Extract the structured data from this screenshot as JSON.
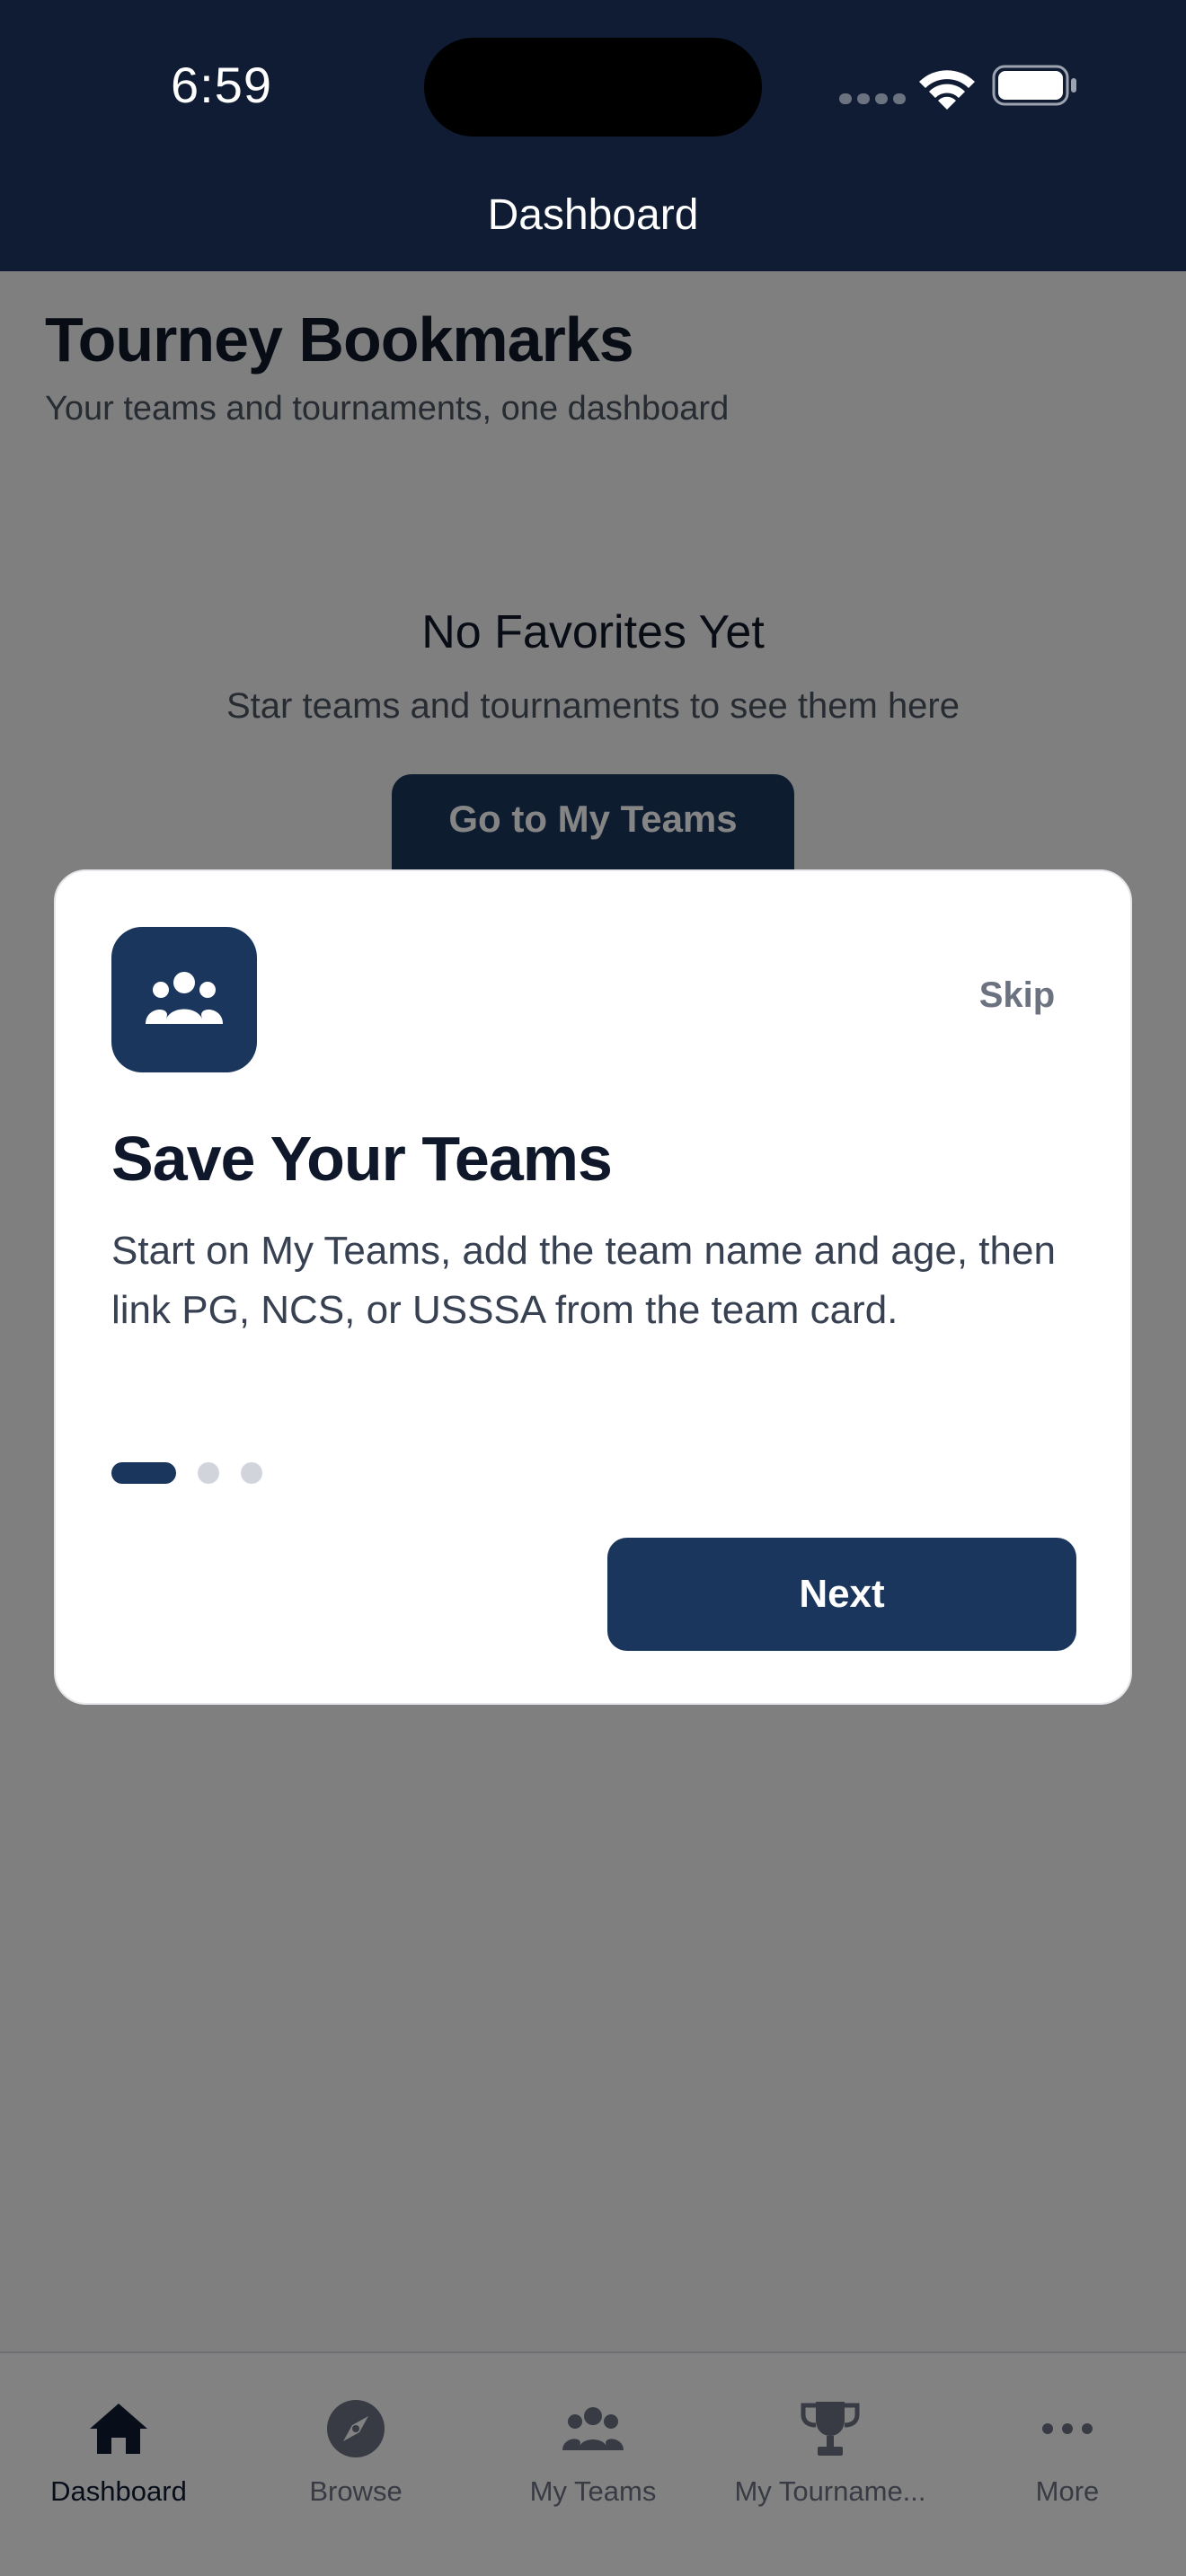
{
  "status_bar": {
    "time": "6:59",
    "icons": [
      "cellular-signal-icon",
      "wifi-icon",
      "battery-icon"
    ]
  },
  "nav": {
    "title": "Dashboard"
  },
  "page": {
    "title": "Tourney Bookmarks",
    "subtitle": "Your teams and tournaments, one dashboard"
  },
  "empty_state": {
    "title": "No Favorites Yet",
    "subtitle": "Star teams and tournaments to see them here",
    "button_label": "Go to My Teams"
  },
  "onboarding": {
    "icon": "team-group-icon",
    "skip_label": "Skip",
    "title": "Save Your Teams",
    "body": "Start on My Teams, add the team name and age, then link PG, NCS, or USSSA from the team card.",
    "steps_total": 3,
    "current_step": 1,
    "next_label": "Next"
  },
  "tabs": [
    {
      "label": "Dashboard",
      "icon": "home-icon",
      "active": true
    },
    {
      "label": "Browse",
      "icon": "compass-icon",
      "active": false
    },
    {
      "label": "My Teams",
      "icon": "team-group-icon",
      "active": false
    },
    {
      "label": "My Tourname...",
      "icon": "trophy-icon",
      "active": false
    },
    {
      "label": "More",
      "icon": "ellipsis-icon",
      "active": false
    }
  ],
  "colors": {
    "nav_background": "#0f1c33",
    "primary": "#1b365d",
    "page_background": "#f3f4f6",
    "overlay": "rgba(0,0,0,0.48)"
  }
}
